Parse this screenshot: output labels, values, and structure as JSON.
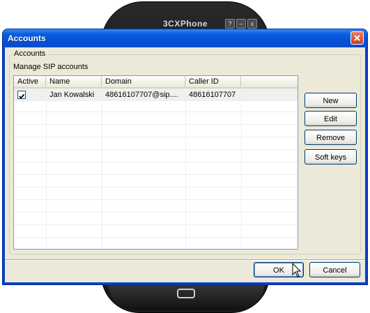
{
  "background_app": {
    "title": "3CXPhone",
    "buttons": [
      "?",
      "–",
      "x"
    ]
  },
  "window": {
    "title": "Accounts",
    "close_icon": "close-icon"
  },
  "group": {
    "label": "Accounts",
    "description": "Manage SIP accounts"
  },
  "table": {
    "columns": [
      "Active",
      "Name",
      "Domain",
      "Caller ID",
      ""
    ],
    "rows": [
      {
        "active": true,
        "name": "Jan Kowalski",
        "domain": "48616107707@sip....",
        "caller_id": "48616107707"
      }
    ]
  },
  "side_buttons": {
    "new": "New",
    "edit": "Edit",
    "remove": "Remove",
    "soft_keys": "Soft keys"
  },
  "footer_buttons": {
    "ok": "OK",
    "cancel": "Cancel"
  }
}
